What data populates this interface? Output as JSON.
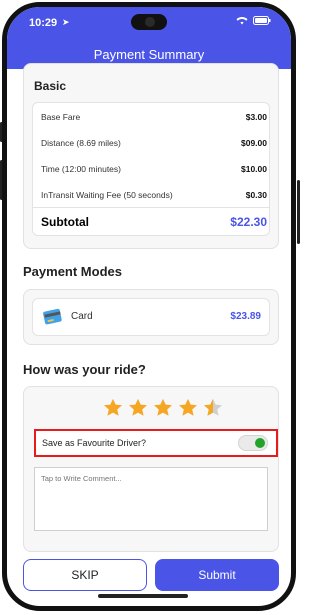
{
  "status": {
    "time": "10:29"
  },
  "header": {
    "title": "Payment Summary"
  },
  "basic": {
    "heading": "Basic",
    "rows": [
      {
        "label": "Base Fare",
        "value": "$3.00"
      },
      {
        "label": "Distance (8.69 miles)",
        "value": "$09.00"
      },
      {
        "label": "Time (12:00 minutes)",
        "value": "$10.00"
      },
      {
        "label": "InTransit Waiting Fee (50 seconds)",
        "value": "$0.30"
      }
    ],
    "subtotal_label": "Subtotal",
    "subtotal_value": "$22.30"
  },
  "payment": {
    "heading": "Payment Modes",
    "method_label": "Card",
    "method_amount": "$23.89"
  },
  "rating": {
    "heading": "How was your ride?",
    "stars_value": 4.5,
    "stars_max": 5,
    "favourite_label": "Save as Favourite Driver?",
    "favourite_on": true,
    "comment_placeholder": "Tap to Write Comment..."
  },
  "actions": {
    "skip_label": "SKIP",
    "submit_label": "Submit"
  },
  "colors": {
    "accent": "#4a55e8",
    "star": "#f5a623",
    "toggle_on": "#22a32a",
    "highlight": "#e41c1c"
  }
}
